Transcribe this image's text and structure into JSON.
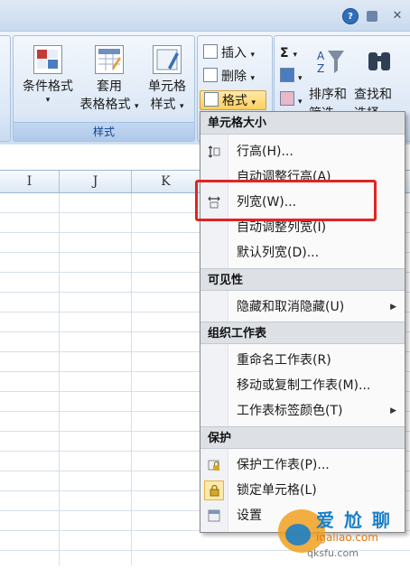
{
  "ribbon": {
    "cond_format": "条件格式",
    "table_format_1": "套用",
    "table_format_2": "表格格式",
    "cell_style_1": "单元格",
    "cell_style_2": "样式",
    "styles_group": "样式",
    "insert": "插入",
    "delete": "删除",
    "format": "格式",
    "sort_1": "排序和",
    "sort_2": "筛选",
    "find_1": "查找和",
    "find_2": "选择",
    "sigma": "Σ"
  },
  "columns": [
    "I",
    "J",
    "K"
  ],
  "menu": {
    "sec_cell_size": "单元格大小",
    "row_height": "行高(H)...",
    "autofit_row": "自动调整行高(A)",
    "col_width": "列宽(W)...",
    "autofit_col": "自动调整列宽(I)",
    "default_width": "默认列宽(D)...",
    "sec_visibility": "可见性",
    "hide_unhide": "隐藏和取消隐藏(U)",
    "sec_organize": "组织工作表",
    "rename_sheet": "重命名工作表(R)",
    "move_copy_sheet": "移动或复制工作表(M)...",
    "tab_color": "工作表标签颜色(T)",
    "sec_protect": "保护",
    "protect_sheet": "保护工作表(P)...",
    "lock_cell": "锁定单元格(L)",
    "format_cells": "设置"
  },
  "watermark": {
    "line1": "爱 尬 聊",
    "line2": "igaliao.com",
    "line3": "qksfu.com"
  },
  "colors": {
    "highlight": "#e02424",
    "ribbon_text": "#15428b",
    "menu_section_bg": "#dde1e6"
  }
}
